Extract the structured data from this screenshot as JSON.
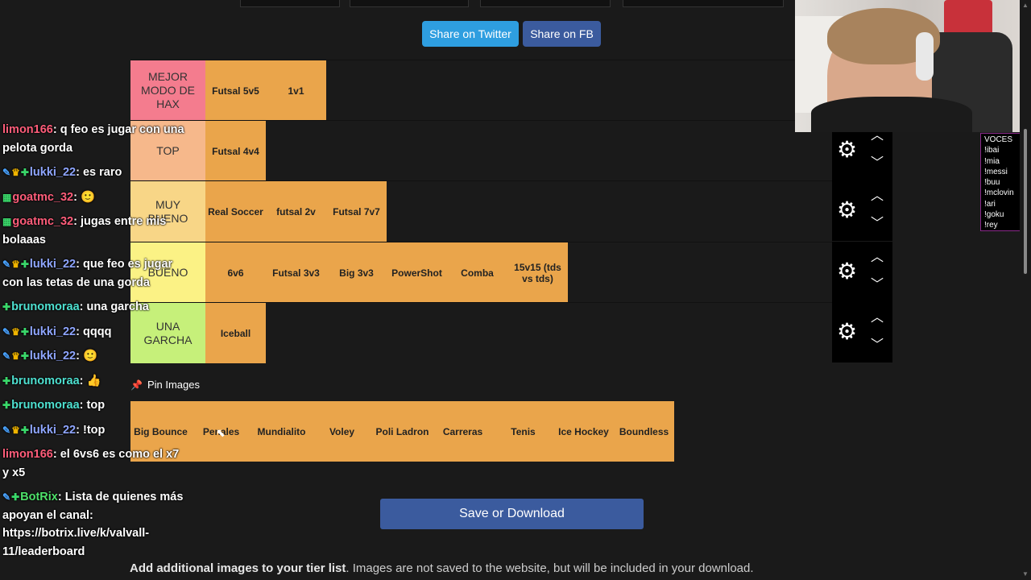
{
  "share": {
    "twitter_label": "Share on Twitter",
    "fb_label": "Share on FB"
  },
  "tiers": [
    {
      "label": "MEJOR MODO DE HAX",
      "color": "#f47c8e",
      "items": [
        "Futsal 5v5",
        "1v1"
      ]
    },
    {
      "label": "TOP",
      "color": "#f6b88b",
      "items": [
        "Futsal 4v4"
      ]
    },
    {
      "label": "MUY BUENO",
      "color": "#f8d687",
      "items": [
        "Real Soccer",
        "futsal 2v",
        "Futsal 7v7"
      ]
    },
    {
      "label": "BUENO",
      "color": "#fbf285",
      "items": [
        "6v6",
        "Futsal 3v3",
        "Big 3v3",
        "PowerShot",
        "Comba",
        "15v15 (tds vs tds)"
      ]
    },
    {
      "label": "UNA GARCHA",
      "color": "#c6f07a",
      "items": [
        "Iceball"
      ]
    }
  ],
  "pin_label": "Pin Images",
  "bank_items": [
    "Big Bounce",
    "Penales",
    "Mundialito",
    "Voley",
    "Poli Ladron",
    "Carreras",
    "Tenis",
    "Ice Hockey",
    "Boundless"
  ],
  "item_color": "#eaa54b",
  "save_label": "Save or Download",
  "info": {
    "bold": "Add additional images to your tier list",
    "rest": ". Images are not saved to the website, but will be included in your download."
  },
  "voces": [
    "VOCES",
    "!ibai",
    "!mia",
    "!messi",
    "!buu",
    "!mclovin",
    "!ari",
    "!goku",
    "!rey"
  ],
  "chat": [
    {
      "badges": [],
      "user": "limon166",
      "user_color": "#ff5d7a",
      "text": "q feo es jugar con una pelota gorda"
    },
    {
      "badges": [
        "sword",
        "crown",
        "gem"
      ],
      "user": "lukki_22",
      "user_color": "#8fa6ff",
      "text": "es raro"
    },
    {
      "badges": [
        "gc"
      ],
      "user": "goatmc_32",
      "user_color": "#ff5d7a",
      "text": "🙂"
    },
    {
      "badges": [
        "gc"
      ],
      "user": "goatmc_32",
      "user_color": "#ff5d7a",
      "text": "jugas entre mis bolaaas"
    },
    {
      "badges": [
        "sword",
        "crown",
        "gem"
      ],
      "user": "lukki_22",
      "user_color": "#8fa6ff",
      "text": "que feo es jugar con las tetas de una gorda"
    },
    {
      "badges": [
        "gem"
      ],
      "user": "brunomoraa",
      "user_color": "#4ee0d0",
      "text": "una garcha"
    },
    {
      "badges": [
        "sword",
        "crown",
        "gem"
      ],
      "user": "lukki_22",
      "user_color": "#8fa6ff",
      "text": "qqqq"
    },
    {
      "badges": [
        "sword",
        "crown",
        "gem"
      ],
      "user": "lukki_22",
      "user_color": "#8fa6ff",
      "text": "🙂"
    },
    {
      "badges": [
        "gem"
      ],
      "user": "brunomoraa",
      "user_color": "#4ee0d0",
      "text": "👍"
    },
    {
      "badges": [
        "gem"
      ],
      "user": "brunomoraa",
      "user_color": "#4ee0d0",
      "text": "top"
    },
    {
      "badges": [
        "sword",
        "crown",
        "gem"
      ],
      "user": "lukki_22",
      "user_color": "#8fa6ff",
      "text": "!top"
    },
    {
      "badges": [],
      "user": "limon166",
      "user_color": "#ff5d7a",
      "text": "el 6vs6 es como el x7 y x5"
    },
    {
      "badges": [
        "sword",
        "gem"
      ],
      "user": "BotRix",
      "user_color": "#4ee06a",
      "text": "Lista de quienes más apoyan el canal: https://botrix.live/k/valvall-11/leaderboard"
    }
  ]
}
